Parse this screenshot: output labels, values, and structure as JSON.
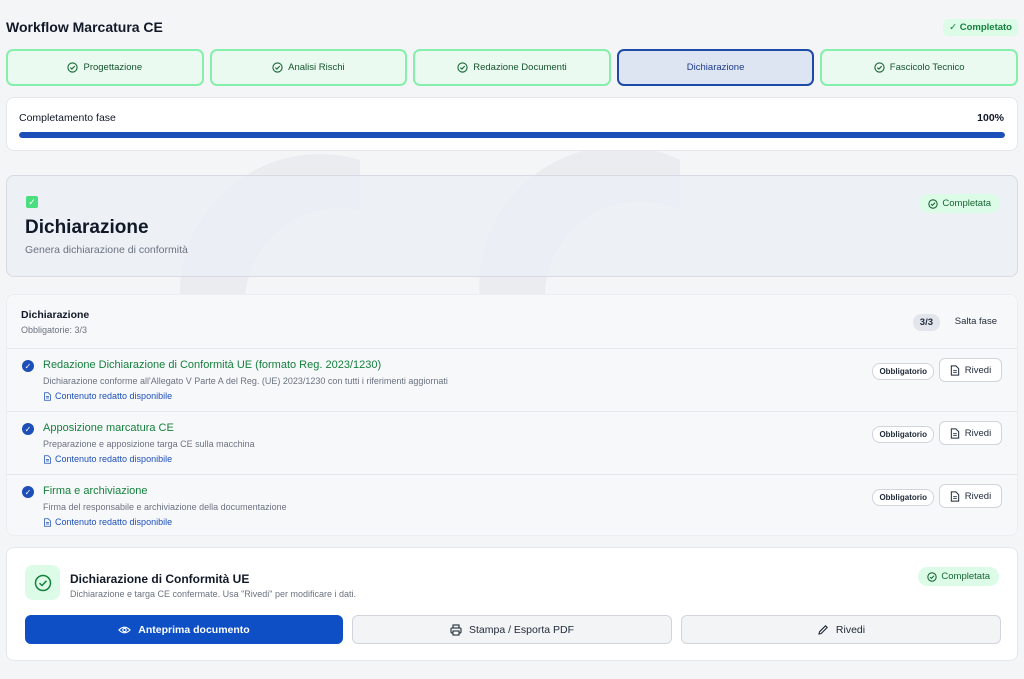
{
  "header": {
    "title": "Workflow Marcatura CE",
    "status": "✓ Completato"
  },
  "steps": [
    {
      "label": "Progettazione"
    },
    {
      "label": "Analisi Rischi"
    },
    {
      "label": "Redazione Documenti"
    },
    {
      "label": "Dichiarazione"
    },
    {
      "label": "Fascicolo Tecnico"
    }
  ],
  "progress": {
    "label": "Completamento fase",
    "percent_text": "100%",
    "value": 100
  },
  "hero": {
    "title": "Dichiarazione",
    "subtitle": "Genera dichiarazione di conformità",
    "status": "Completata"
  },
  "checklist": {
    "title": "Dichiarazione",
    "subtitle": "Obbligatorie: 3/3",
    "count": "3/3",
    "skip_label": "Salta fase",
    "items": [
      {
        "title": "Redazione Dichiarazione di Conformità UE (formato Reg. 2023/1230)",
        "desc": "Dichiarazione conforme all'Allegato V Parte A del Reg. (UE) 2023/1230 con tutti i riferimenti aggiornati",
        "link": "Contenuto redatto disponibile",
        "tag": "Obbligatorio",
        "button": "Rivedi"
      },
      {
        "title": "Apposizione marcatura CE",
        "desc": "Preparazione e apposizione targa CE sulla macchina",
        "link": "Contenuto redatto disponibile",
        "tag": "Obbligatorio",
        "button": "Rivedi"
      },
      {
        "title": "Firma e archiviazione",
        "desc": "Firma del responsabile e archiviazione della documentazione",
        "link": "Contenuto redatto disponibile",
        "tag": "Obbligatorio",
        "button": "Rivedi"
      }
    ]
  },
  "final": {
    "title": "Dichiarazione di Conformità UE",
    "subtitle": "Dichiarazione e targa CE confermate. Usa \"Rivedi\" per modificare i dati.",
    "status": "Completata",
    "preview_label": "Anteprima documento",
    "print_label": "Stampa / Esporta PDF",
    "review_label": "Rivedi"
  },
  "colors": {
    "accent": "#0e4fc6",
    "success": "#15803d",
    "success_bg": "#dcfce7"
  }
}
